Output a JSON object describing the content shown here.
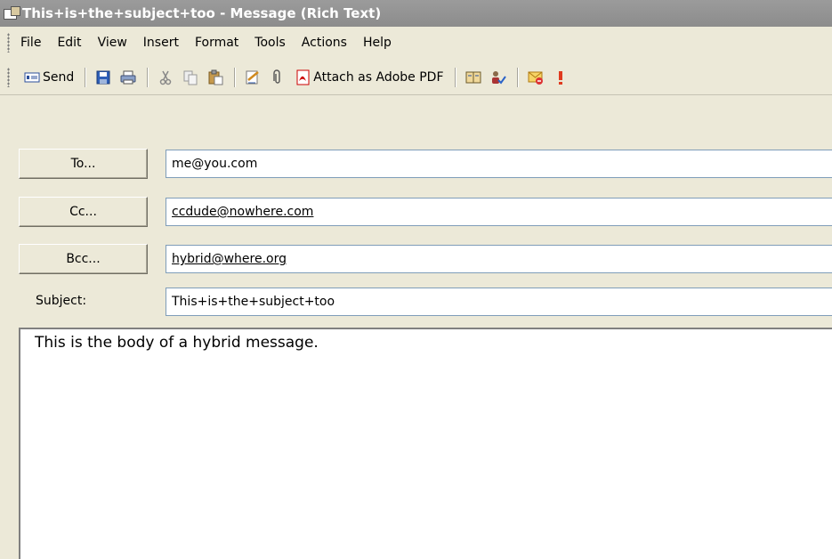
{
  "window": {
    "title": "This+is+the+subject+too - Message (Rich Text)",
    "icon": "message-window-icon"
  },
  "menu": {
    "items": [
      "File",
      "Edit",
      "View",
      "Insert",
      "Format",
      "Tools",
      "Actions",
      "Help"
    ]
  },
  "toolbar": {
    "send_label": "Send",
    "attach_pdf_label": "Attach as Adobe PDF",
    "icons": [
      "send-icon",
      "save-icon",
      "print-icon",
      "cut-icon",
      "copy-icon",
      "paste-icon",
      "signature-icon",
      "paperclip-icon",
      "adobe-pdf-icon",
      "address-book-icon",
      "check-names-icon",
      "options-icon",
      "importance-high-icon"
    ]
  },
  "headers": {
    "to_button": "To...",
    "to_value": "me@you.com",
    "cc_button": "Cc...",
    "cc_value": "ccdude@nowhere.com",
    "bcc_button": "Bcc...",
    "bcc_value": "hybrid@where.org",
    "subject_label": "Subject:",
    "subject_value": "This+is+the+subject+too"
  },
  "message": {
    "body": "This is the body of a hybrid message."
  },
  "colors": {
    "titlebar": "#8f8f8f",
    "chrome": "#ece9d8",
    "input_border": "#7f9db9"
  }
}
